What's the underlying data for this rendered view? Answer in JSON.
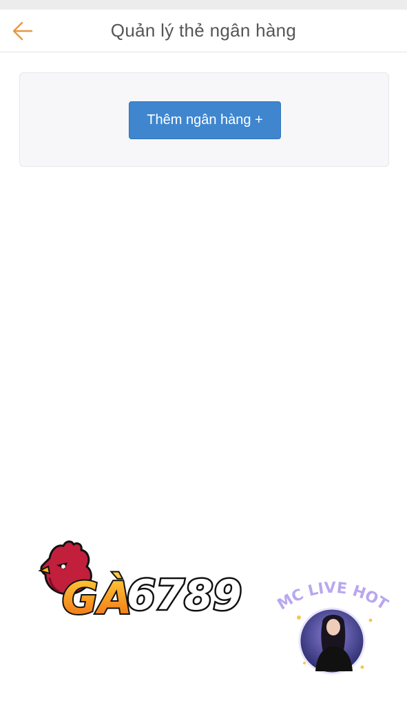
{
  "nav": {
    "title": "Quản lý thẻ ngân hàng",
    "back_icon": "arrow-left-icon",
    "accent": "#e8963f"
  },
  "bank_panel": {
    "add_button_label": "Thêm ngân hàng +",
    "button_color": "#3f86cf"
  },
  "overlays": {
    "brand_logo_text": "GÀ6789",
    "live_badge_text": "MC LIVE HOT"
  }
}
